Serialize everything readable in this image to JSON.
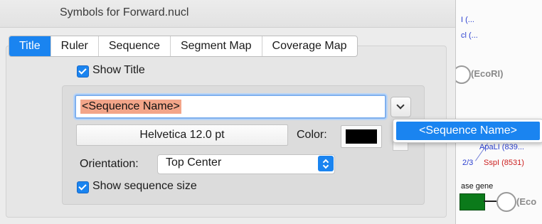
{
  "window": {
    "title": "Symbols for Forward.nucl"
  },
  "tabs": [
    {
      "label": "Title",
      "active": true
    },
    {
      "label": "Ruler",
      "active": false
    },
    {
      "label": "Sequence",
      "active": false
    },
    {
      "label": "Segment Map",
      "active": false
    },
    {
      "label": "Coverage Map",
      "active": false
    }
  ],
  "show_title": {
    "label": "Show Title",
    "checked": true
  },
  "title_field": {
    "value": "<Sequence Name>"
  },
  "font_button": {
    "label": "Helvetica 12.0 pt"
  },
  "color": {
    "label": "Color:",
    "value": "#000000"
  },
  "orientation": {
    "label": "Orientation:",
    "value": "Top Center"
  },
  "show_size": {
    "label": "Show sequence size",
    "checked": true
  },
  "menu": {
    "item": "<Sequence Name>"
  },
  "background_map": {
    "labels": {
      "l1": "I (...",
      "l2": "cl (...",
      "ecori": "(EcoRI)",
      "apali": "ApaLI (839...",
      "frac": "2/3",
      "sspi": "SspI (8531)",
      "gene": "ase gene",
      "eco": "(Eco"
    }
  },
  "accent": "#1a84f0"
}
